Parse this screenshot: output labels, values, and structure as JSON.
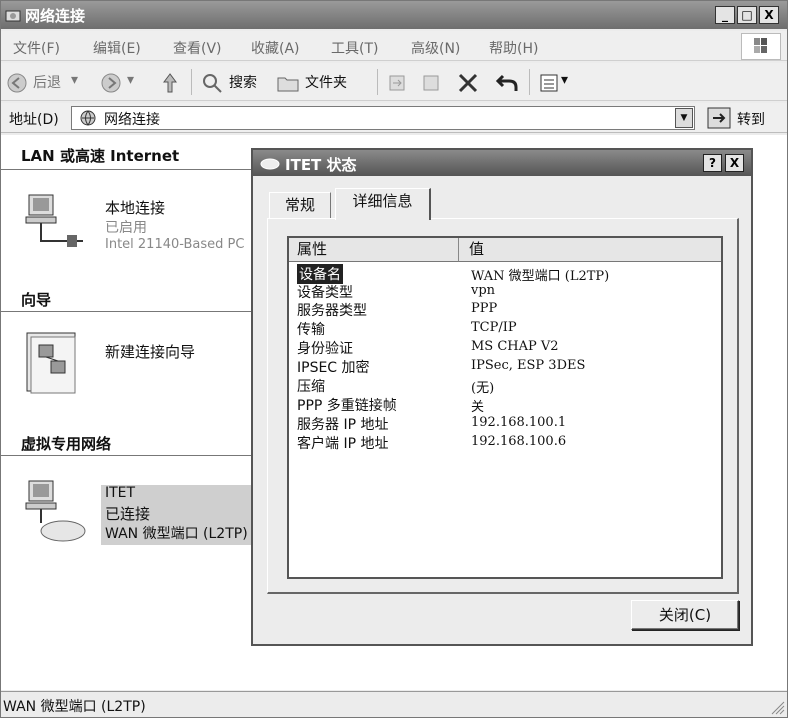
{
  "window": {
    "title": "网络连接",
    "controls": {
      "minimize": "_",
      "maximize": "□",
      "close": "X"
    }
  },
  "menu": [
    {
      "label": "文件(F)"
    },
    {
      "label": "编辑(E)"
    },
    {
      "label": "查看(V)"
    },
    {
      "label": "收藏(A)"
    },
    {
      "label": "工具(T)"
    },
    {
      "label": "高级(N)"
    },
    {
      "label": "帮助(H)"
    }
  ],
  "toolbar": {
    "back": "后退",
    "search": "搜索",
    "folders": "文件夹"
  },
  "address": {
    "label": "地址(D)",
    "value": "网络连接",
    "go": "转到"
  },
  "sections": {
    "lan": "LAN 或高速 Internet",
    "wizard": "向导",
    "vpn": "虚拟专用网络"
  },
  "items": {
    "local": {
      "title": "本地连接",
      "status": "已启用",
      "device": "Intel 21140-Based PC"
    },
    "wizard": {
      "title": "新建连接向导"
    },
    "itet": {
      "title": "ITET",
      "status": "已连接",
      "device": "WAN 微型端口 (L2TP)"
    }
  },
  "statusbar": {
    "text": "WAN 微型端口 (L2TP)"
  },
  "dialog": {
    "title": "ITET 状态",
    "help": "?",
    "close_x": "X",
    "tabs": [
      {
        "label": "常规"
      },
      {
        "label": "详细信息"
      }
    ],
    "columns": {
      "property": "属性",
      "value": "值"
    },
    "rows": [
      {
        "property": "设备名",
        "value": "WAN 微型端口 (L2TP)"
      },
      {
        "property": "设备类型",
        "value": "vpn"
      },
      {
        "property": "服务器类型",
        "value": "PPP"
      },
      {
        "property": "传输",
        "value": "TCP/IP"
      },
      {
        "property": "身份验证",
        "value": "MS CHAP V2"
      },
      {
        "property": "IPSEC 加密",
        "value": "IPSec, ESP 3DES"
      },
      {
        "property": "压缩",
        "value": "(无)"
      },
      {
        "property": "PPP 多重链接帧",
        "value": "关"
      },
      {
        "property": "服务器 IP 地址",
        "value": "192.168.100.1"
      },
      {
        "property": "客户端 IP 地址",
        "value": "192.168.100.6"
      }
    ],
    "close_button": "关闭(C)"
  },
  "colors": {
    "selection": "#222222",
    "titlebar": "#6e6e6e"
  }
}
